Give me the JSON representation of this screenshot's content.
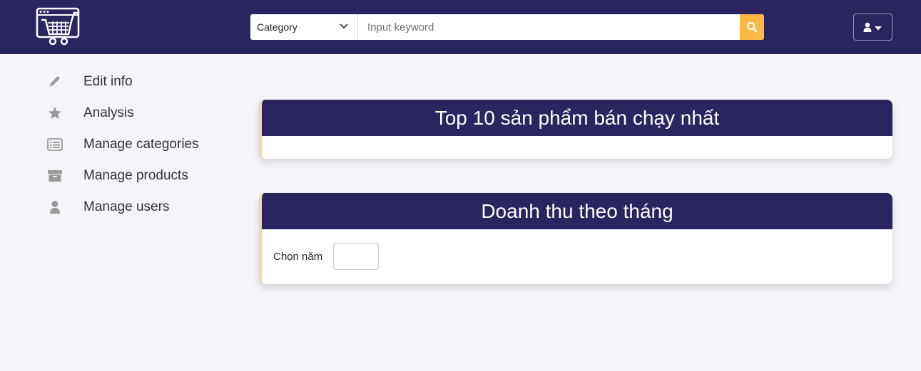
{
  "header": {
    "logo_icon": "shopping-cart-browser-icon",
    "search": {
      "category_label": "Category",
      "keyword_placeholder": "Input keyword",
      "keyword_value": "",
      "search_icon": "search-icon",
      "button_color": "#fdb743"
    },
    "user_menu_icon": "user-icon"
  },
  "sidebar": {
    "items": [
      {
        "label": "Edit info",
        "icon": "pencil-icon"
      },
      {
        "label": "Analysis",
        "icon": "star-icon"
      },
      {
        "label": "Manage categories",
        "icon": "list-icon"
      },
      {
        "label": "Manage products",
        "icon": "archive-box-icon"
      },
      {
        "label": "Manage users",
        "icon": "user-icon"
      }
    ]
  },
  "main": {
    "top_products": {
      "title": "Top 10 sản phẩm bán chạy nhất"
    },
    "monthly_revenue": {
      "title": "Doanh thu theo tháng",
      "year_label": "Chọn năm",
      "year_value": ""
    }
  },
  "colors": {
    "navbar": "#2a2460",
    "accent": "#fdb743",
    "background": "#f4f4f9"
  }
}
